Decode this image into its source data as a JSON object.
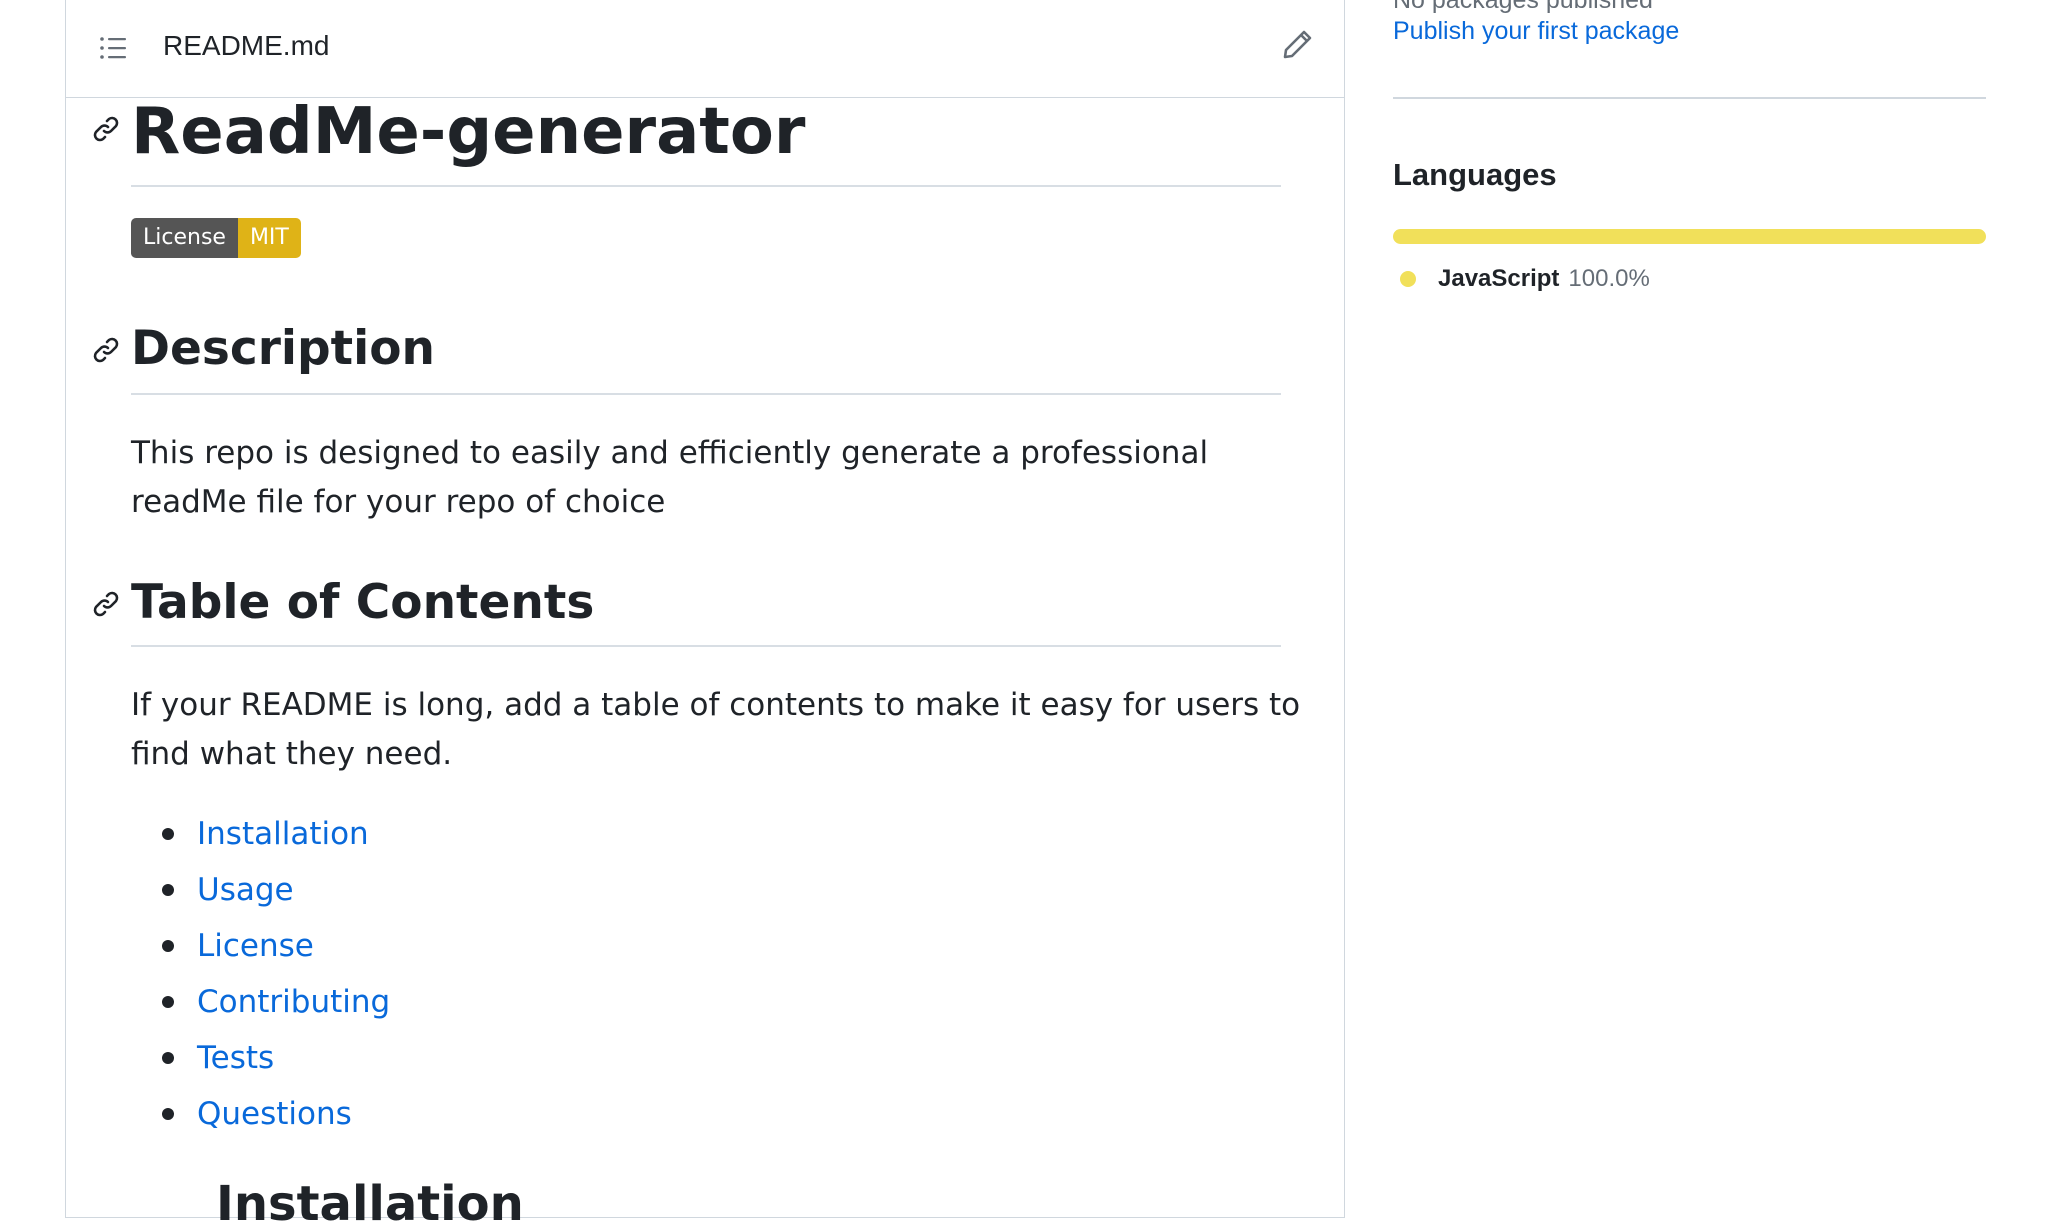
{
  "readme": {
    "filename": "README.md",
    "title": "ReadMe-generator",
    "badge": {
      "label": "License",
      "value": "MIT"
    },
    "description_heading": "Description",
    "description_text": "This repo is designed to easily and efficiently generate a professional readMe file for your repo of choice",
    "toc_heading": "Table of Contents",
    "toc_intro": "If your README is long, add a table of contents to make it easy for users to find what they need.",
    "toc_items": [
      "Installation",
      "Usage",
      "License",
      "Contributing",
      "Tests",
      "Questions"
    ],
    "next_heading_partial": "Installation"
  },
  "sidebar": {
    "packages_status": "No packages published",
    "packages_link": "Publish your first package",
    "languages_title": "Languages",
    "languages": [
      {
        "name": "JavaScript",
        "percent": "100.0%",
        "color": "#f1e05a",
        "share": 1.0
      }
    ]
  },
  "icons": {
    "toc": "list-unordered-icon",
    "edit": "pencil-icon",
    "anchor": "link-icon"
  },
  "colors": {
    "link": "#0969da",
    "badge_left": "#555555",
    "badge_right": "#dfb317",
    "javascript": "#f1e05a"
  }
}
